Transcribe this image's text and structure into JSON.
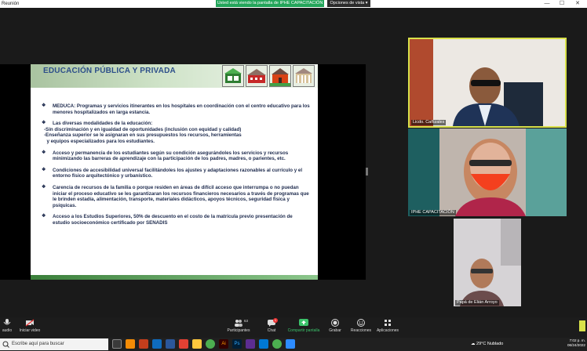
{
  "window": {
    "title": "Reunión",
    "share_banner": "Usted está viendo la pantalla de IPHE CAPACITACIÓN",
    "view_options": "Opciones de vista",
    "min_symbol": "—",
    "max_symbol": "☐",
    "close_symbol": "✕"
  },
  "slide": {
    "title": "EDUCACIÓN PÚBLICA Y PRIVADA",
    "bullets": [
      {
        "lines": [
          "MEDUCA: Programas y servicios itinerantes en los hospitales en coordinación con el centro educativo para los menores hospitalizados en larga estancia."
        ]
      },
      {
        "lines": [
          "Las diversas modalidades de la educación:",
          "-Sin discriminación y en igualdad de oportunidades (inclusión con equidad y calidad)",
          "-Enseñanza superior se le asignaran en sus presupuestos los recursos, herramientas",
          "  y equipos especializados para los estudiantes."
        ]
      },
      {
        "lines": [
          "Acceso y permanencia de los estudiantes según su condición  asegurándoles los servicios y recursos minimizando las barreras de aprendizaje con la participación  de los padres, madres, o parientes, etc."
        ]
      },
      {
        "lines": [
          "Condiciones de accesibilidad universal facilitándoles los ajustes y adaptaciones razonables al currículo y el entorno físico arquitectónico y urbanístico."
        ]
      },
      {
        "lines": [
          "Carencia de recursos de la familia o porque residen en áreas de difícil acceso que interrumpa o no puedan iniciar el proceso educativo se les garantizaran los recursos financieros necesarios a través de programas que le brinden estadía, alimentación, transporte, materiales didácticos, apoyos técnicos, seguridad física y psíquicas."
        ]
      },
      {
        "lines": [
          "Acceso a los Estudios Superiores, 50% de descuento en el costo de la matrícula previo presentación de estudio socioeconómico certificado por SENADIS"
        ]
      }
    ],
    "bullet_symbol": "❖"
  },
  "participants": [
    {
      "name": "Licdo. Cañizales"
    },
    {
      "name": "IPHE CAPACITACIÓN"
    },
    {
      "name": "Papá de Elián Arroyo"
    }
  ],
  "toolbar": {
    "audio": "audio",
    "video": "Iniciar video",
    "participants": "Participantes",
    "participants_count": "63",
    "chat": "Chat",
    "chat_badge": "1",
    "share": "Compartir pantalla",
    "record": "Grabar",
    "reactions": "Reacciones",
    "apps": "Aplicaciones"
  },
  "taskbar": {
    "search_placeholder": "Escribe aquí para buscar",
    "weather_temp": "29°C",
    "weather_text": "Nublado",
    "time": "7:02 p. m.",
    "date": "06/24/2022"
  },
  "colors": {
    "share_green": "#23a55a",
    "active_speaker": "#d8e14a",
    "slide_title": "#2d4f8a"
  }
}
